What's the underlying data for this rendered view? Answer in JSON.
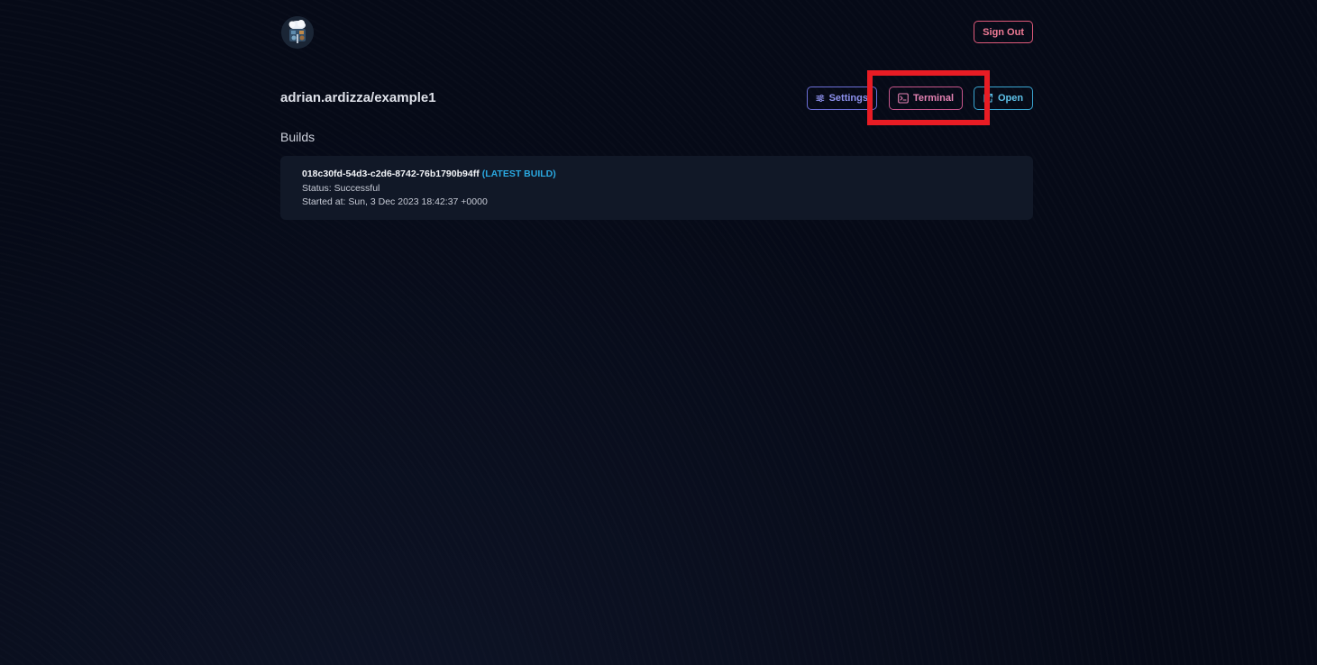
{
  "header": {
    "sign_out_label": "Sign Out"
  },
  "repo": {
    "title": "adrian.ardizza/example1"
  },
  "actions": {
    "settings_label": "Settings",
    "terminal_label": "Terminal",
    "open_label": "Open"
  },
  "builds": {
    "section_title": "Builds",
    "items": [
      {
        "id": "018c30fd-54d3-c2d6-8742-76b1790b94ff",
        "badge": "(LATEST BUILD)",
        "status": "Status: Successful",
        "started_at": "Started at: Sun, 3 Dec 2023 18:42:37 +0000"
      }
    ]
  },
  "colors": {
    "background": "#060a17",
    "card": "#111827",
    "settings_accent": "#8e92ef",
    "terminal_accent": "#e482b3",
    "open_accent": "#5ec2ea",
    "signout_accent": "#f07b96",
    "badge_accent": "#2aa8e0",
    "highlight_box": "#e81c24"
  },
  "icons": {
    "logo": "logo-avatar",
    "settings": "sliders-icon",
    "terminal": "terminal-icon",
    "open": "external-link-icon"
  }
}
